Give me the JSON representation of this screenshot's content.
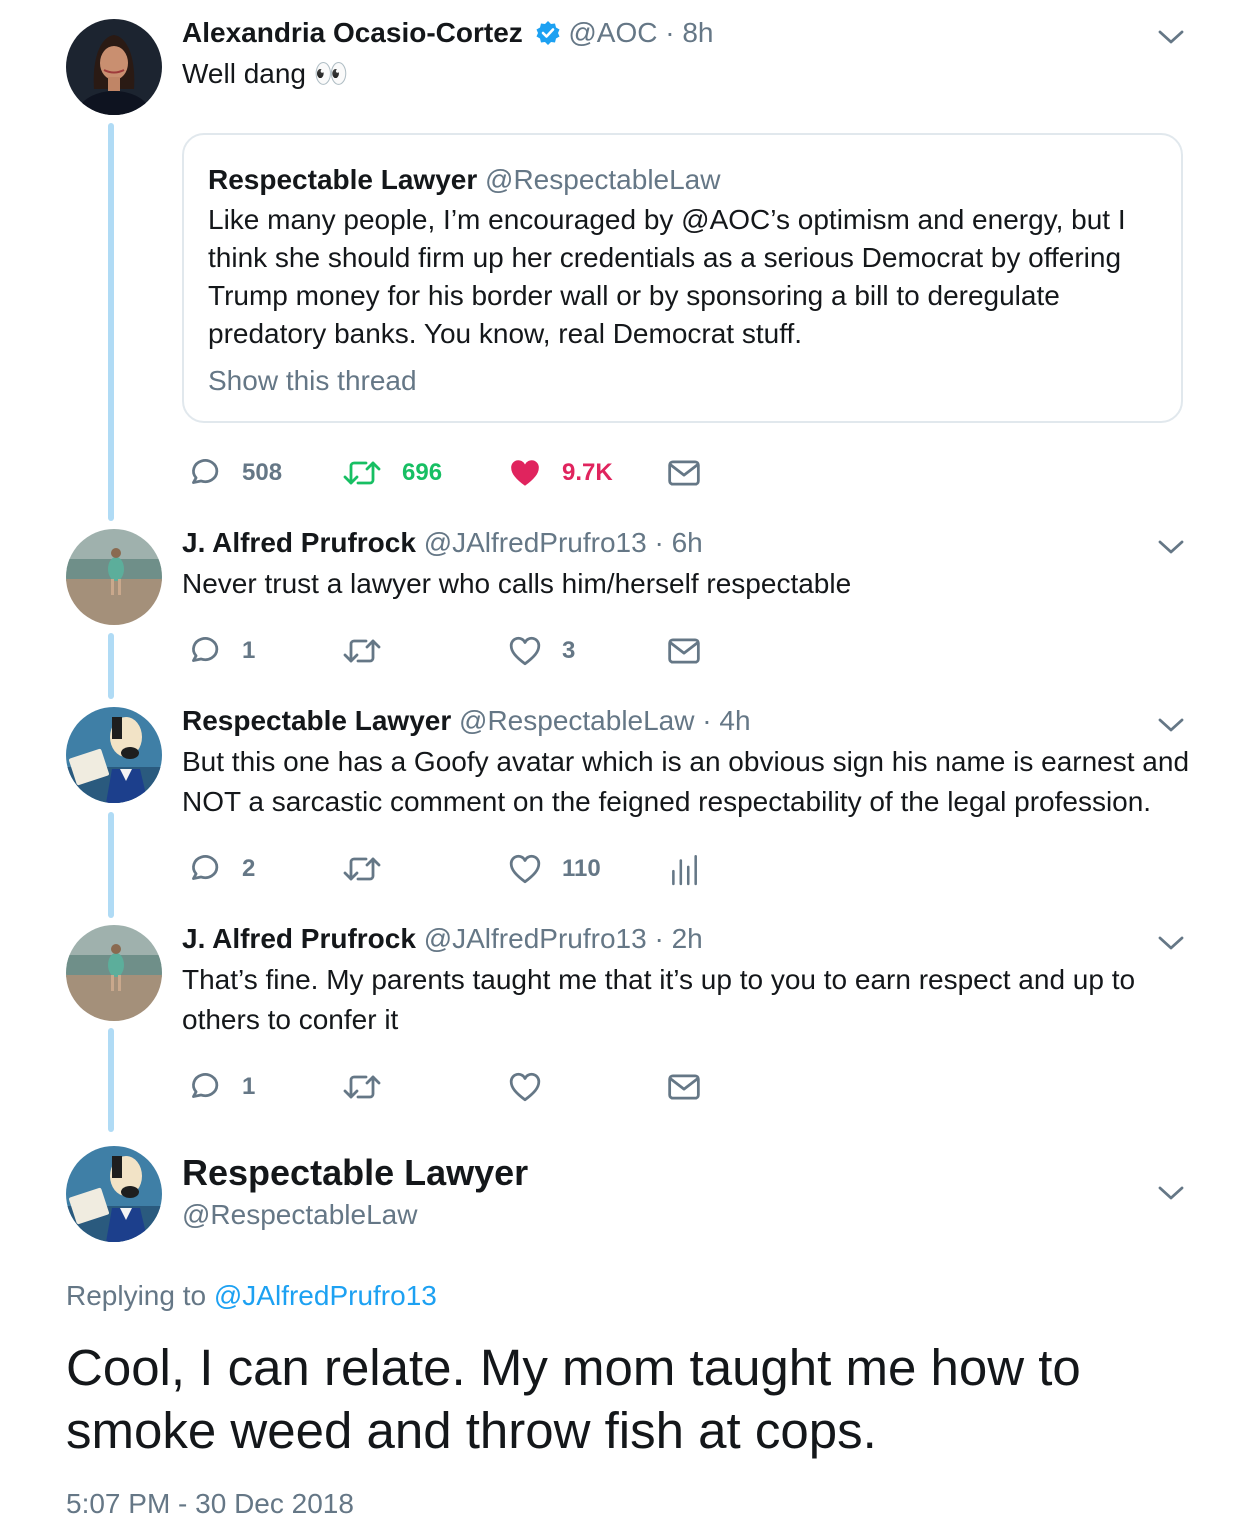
{
  "tweets": [
    {
      "name": "Alexandria Ocasio-Cortez",
      "handle": "@AOC",
      "time": "8h",
      "text": "Well dang 👀",
      "quote": {
        "name": "Respectable Lawyer",
        "handle": "@RespectableLaw",
        "lines": [
          "Like many people, I’m encouraged by @AOC’s optimism and energy, but I",
          "think she should firm up her credentials as a serious Democrat by offering",
          "Trump money for his border wall or by sponsoring a bill to deregulate",
          "predatory banks. You know, real Democrat stuff."
        ],
        "show_thread": "Show this thread"
      },
      "replies": "508",
      "retweets": "696",
      "likes": "9.7K"
    },
    {
      "name": "J. Alfred Prufrock",
      "handle": "@JAlfredPrufro13",
      "time": "6h",
      "text": "Never trust a lawyer who calls him/herself respectable",
      "replies": "1",
      "retweets": "",
      "likes": "3"
    },
    {
      "name": "Respectable Lawyer",
      "handle": "@RespectableLaw",
      "time": "4h",
      "lines": [
        "But this one has a Goofy avatar which is an obvious sign his name is earnest and",
        "NOT a sarcastic comment on the feigned respectability of the legal profession."
      ],
      "replies": "2",
      "retweets": "",
      "likes": "110"
    },
    {
      "name": "J. Alfred Prufrock",
      "handle": "@JAlfredPrufro13",
      "time": "2h",
      "lines": [
        "That’s fine. My parents taught me that it’s up to you to earn respect and up to",
        "others to confer it"
      ],
      "replies": "1",
      "retweets": "",
      "likes": ""
    }
  ],
  "main": {
    "name": "Respectable Lawyer",
    "handle": "@RespectableLaw",
    "replying_prefix": "Replying to",
    "replying_to": "@JAlfredPrufro13",
    "lines": [
      "Cool, I can relate. My mom taught me how to",
      "smoke weed and throw fish at cops."
    ],
    "timestamp": "5:07 PM - 30 Dec 2018"
  },
  "separator": "·",
  "colors": {
    "verified": "#1da1f2",
    "retweet_active": "#17bf63",
    "like_active": "#e0245e",
    "muted": "#657786",
    "thread_line": "#b0dbf5"
  },
  "icons": [
    "verified-badge-icon",
    "chevron-down-icon",
    "reply-icon",
    "retweet-icon",
    "heart-icon",
    "message-icon",
    "analytics-icon",
    "eyes-emoji"
  ]
}
